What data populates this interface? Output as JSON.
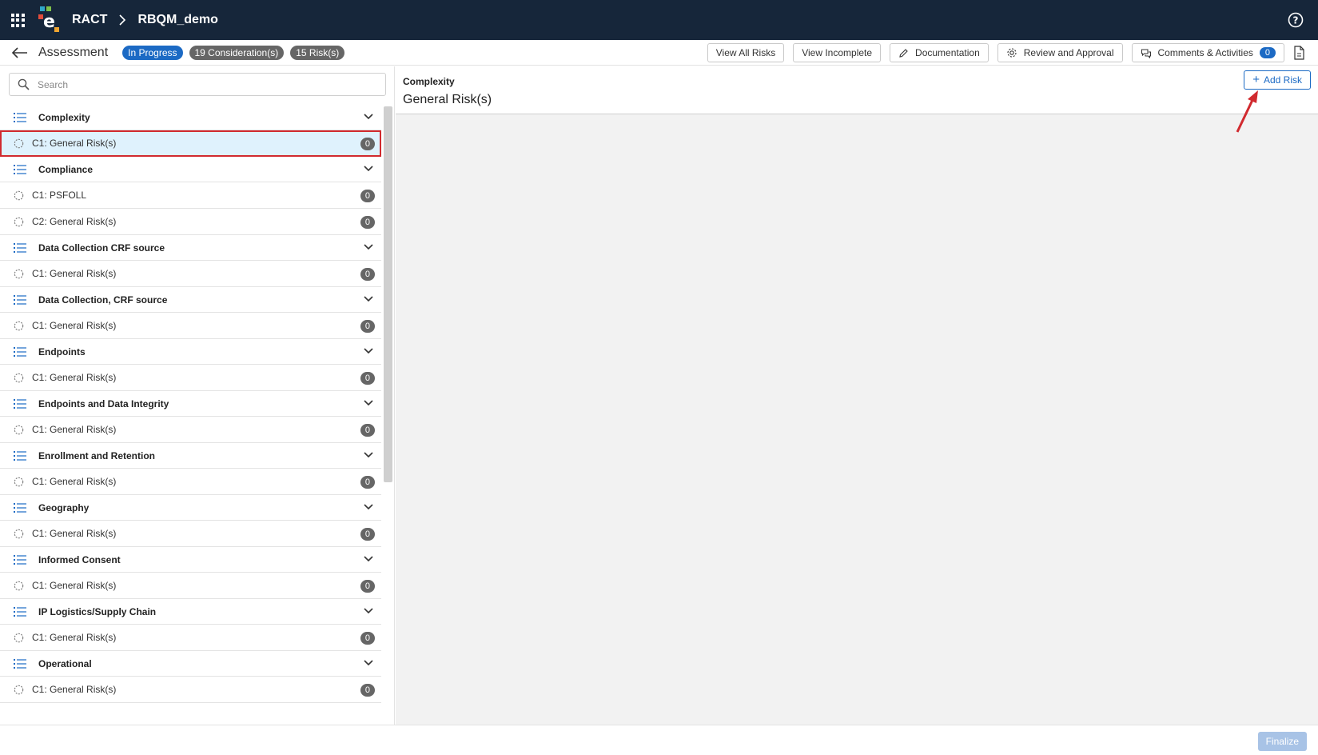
{
  "header": {
    "app_name": "RACT",
    "project_name": "RBQM_demo"
  },
  "subheader": {
    "title": "Assessment",
    "status_badge": "In Progress",
    "considerations_badge": "19 Consideration(s)",
    "risks_badge": "15 Risk(s)",
    "toolbar": {
      "view_all_risks": "View All Risks",
      "view_incomplete": "View Incomplete",
      "documentation": "Documentation",
      "review_and_approval": "Review and Approval",
      "comments_activities": "Comments & Activities",
      "comments_count": "0"
    }
  },
  "sidebar": {
    "search_placeholder": "Search",
    "groups": [
      {
        "label": "Complexity",
        "items": [
          {
            "label": "C1: General Risk(s)",
            "count": "0",
            "selected": true
          }
        ]
      },
      {
        "label": "Compliance",
        "items": [
          {
            "label": "C1: PSFOLL",
            "count": "0"
          },
          {
            "label": "C2: General Risk(s)",
            "count": "0"
          }
        ]
      },
      {
        "label": "Data Collection CRF source",
        "items": [
          {
            "label": "C1: General Risk(s)",
            "count": "0"
          }
        ]
      },
      {
        "label": "Data Collection, CRF source",
        "items": [
          {
            "label": "C1: General Risk(s)",
            "count": "0"
          }
        ]
      },
      {
        "label": "Endpoints",
        "items": [
          {
            "label": "C1: General Risk(s)",
            "count": "0"
          }
        ]
      },
      {
        "label": "Endpoints and Data Integrity",
        "items": [
          {
            "label": "C1: General Risk(s)",
            "count": "0"
          }
        ]
      },
      {
        "label": "Enrollment and Retention",
        "items": [
          {
            "label": "C1: General Risk(s)",
            "count": "0"
          }
        ]
      },
      {
        "label": "Geography",
        "items": [
          {
            "label": "C1: General Risk(s)",
            "count": "0"
          }
        ]
      },
      {
        "label": "Informed Consent",
        "items": [
          {
            "label": "C1: General Risk(s)",
            "count": "0"
          }
        ]
      },
      {
        "label": "IP Logistics/Supply Chain",
        "items": [
          {
            "label": "C1: General Risk(s)",
            "count": "0"
          }
        ]
      },
      {
        "label": "Operational",
        "items": [
          {
            "label": "C1: General Risk(s)",
            "count": "0"
          }
        ]
      }
    ]
  },
  "main": {
    "category": "Complexity",
    "title": "General Risk(s)",
    "add_risk_label": "Add Risk"
  },
  "footer": {
    "finalize_label": "Finalize"
  },
  "colors": {
    "topbar": "#16263a",
    "accent": "#1c6ac4",
    "selected_row": "#dff2fd",
    "highlight": "#d12a2f"
  }
}
